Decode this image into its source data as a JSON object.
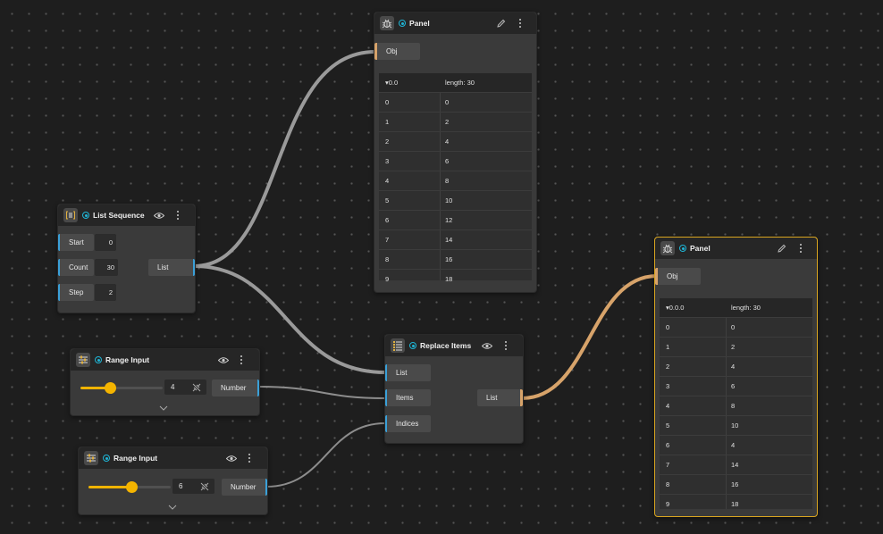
{
  "colors": {
    "canvas": "#1e1e1e",
    "node": "#3a3a3a",
    "header": "#262626",
    "port_accent": "#3aa0d8",
    "object_wire": "#d7a36a",
    "selection": "#d9a520",
    "slider": "#f0b400",
    "status": "#1fb5d6"
  },
  "panel_top": {
    "title": "Panel",
    "icon": "bug-icon",
    "input_label": "Obj",
    "path_label": "0.0",
    "length_label": "length: 30",
    "rows": [
      {
        "index": "0",
        "value": "0"
      },
      {
        "index": "1",
        "value": "2"
      },
      {
        "index": "2",
        "value": "4"
      },
      {
        "index": "3",
        "value": "6"
      },
      {
        "index": "4",
        "value": "8"
      },
      {
        "index": "5",
        "value": "10"
      },
      {
        "index": "6",
        "value": "12"
      },
      {
        "index": "7",
        "value": "14"
      },
      {
        "index": "8",
        "value": "16"
      },
      {
        "index": "9",
        "value": "18"
      }
    ]
  },
  "list_sequence": {
    "title": "List Sequence",
    "icon": "list-sequence-icon",
    "inputs": [
      {
        "label": "Start",
        "value": "0"
      },
      {
        "label": "Count",
        "value": "30"
      },
      {
        "label": "Step",
        "value": "2"
      }
    ],
    "output_label": "List"
  },
  "range_input_1": {
    "title": "Range Input",
    "icon": "sliders-icon",
    "value": "4",
    "slider_fraction": 0.44,
    "output_label": "Number"
  },
  "range_input_2": {
    "title": "Range Input",
    "icon": "sliders-icon",
    "value": "6",
    "slider_fraction": 0.59,
    "output_label": "Number"
  },
  "replace_items": {
    "title": "Replace Items",
    "icon": "replace-items-icon",
    "inputs": [
      "List",
      "Items",
      "Indices"
    ],
    "output_label": "List"
  },
  "panel_right": {
    "title": "Panel",
    "icon": "bug-icon",
    "input_label": "Obj",
    "path_label": "0.0.0",
    "length_label": "length: 30",
    "rows": [
      {
        "index": "0",
        "value": "0"
      },
      {
        "index": "1",
        "value": "2"
      },
      {
        "index": "2",
        "value": "4"
      },
      {
        "index": "3",
        "value": "6"
      },
      {
        "index": "4",
        "value": "8"
      },
      {
        "index": "5",
        "value": "10"
      },
      {
        "index": "6",
        "value": "4"
      },
      {
        "index": "7",
        "value": "14"
      },
      {
        "index": "8",
        "value": "16"
      },
      {
        "index": "9",
        "value": "18"
      }
    ]
  }
}
